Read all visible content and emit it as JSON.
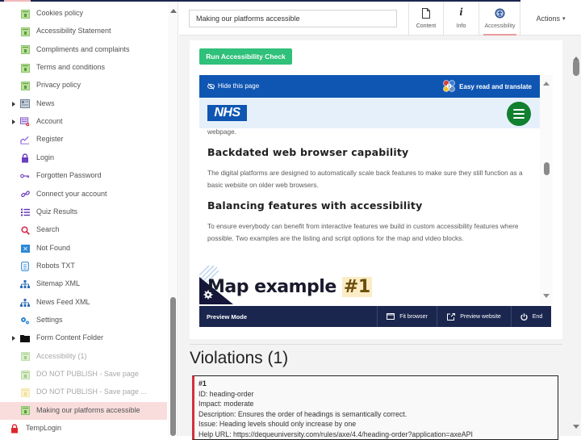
{
  "sidebar": {
    "items": [
      {
        "label": "Cookies policy",
        "icon": "page-icon"
      },
      {
        "label": "Accessibility Statement",
        "icon": "page-icon"
      },
      {
        "label": "Compliments and complaints",
        "icon": "page-icon"
      },
      {
        "label": "Terms and conditions",
        "icon": "page-icon"
      },
      {
        "label": "Privacy policy",
        "icon": "page-icon"
      },
      {
        "label": "News",
        "icon": "news-icon",
        "expandable": true
      },
      {
        "label": "Account",
        "icon": "account-icon",
        "expandable": true
      },
      {
        "label": "Register",
        "icon": "register-icon"
      },
      {
        "label": "Login",
        "icon": "lock-icon"
      },
      {
        "label": "Forgotten Password",
        "icon": "key-icon"
      },
      {
        "label": "Connect your account",
        "icon": "link-icon"
      },
      {
        "label": "Quiz Results",
        "icon": "list-icon"
      },
      {
        "label": "Search",
        "icon": "search-icon"
      },
      {
        "label": "Not Found",
        "icon": "not-found-icon"
      },
      {
        "label": "Robots TXT",
        "icon": "robots-icon"
      },
      {
        "label": "Sitemap XML",
        "icon": "sitemap-icon"
      },
      {
        "label": "News Feed XML",
        "icon": "sitemap-icon"
      },
      {
        "label": "Settings",
        "icon": "settings-icon"
      },
      {
        "label": "Form Content Folder",
        "icon": "folder-icon",
        "expandable": true
      },
      {
        "label": "Accessibility (1)",
        "icon": "page-icon",
        "unpublished": true
      },
      {
        "label": "DO NOT PUBLISH - Save page",
        "icon": "page-icon",
        "unpublished": true
      },
      {
        "label": "DO NOT PUBLISH - Save page ...",
        "icon": "form-icon",
        "unpublished": true
      },
      {
        "label": "Making our platforms accessible",
        "icon": "page-icon",
        "selected": true
      },
      {
        "label": "TempLogin",
        "icon": "red-lock-icon",
        "root": true
      }
    ]
  },
  "header": {
    "page_title": "Making our platforms accessible",
    "tabs": [
      {
        "label": "Content",
        "icon": "document-icon"
      },
      {
        "label": "Info",
        "icon": "info-icon"
      },
      {
        "label": "Accessibility",
        "icon": "accessibility-icon",
        "active": true
      }
    ],
    "actions_label": "Actions",
    "actions_caret": "▾"
  },
  "accessibility": {
    "run_button": "Run Accessibility Check",
    "preview": {
      "hide_label": "Hide this page",
      "easy_read_label": "Easy read and translate",
      "logo_text": "NHS",
      "intro_tail": "webpage.",
      "sections": [
        {
          "heading": "Backdated web browser capability",
          "body": "The digital platforms are designed to automatically scale back features to make sure they still function as a basic website on older web browsers."
        },
        {
          "heading": "Balancing features with accessibility",
          "body": "To ensure everybody can benefit from interactive features we build in custom accessibility features where possible. Two examples are the listing and script options for the map and video blocks."
        }
      ],
      "map_title": "Map example",
      "map_title_highlight": "#1"
    },
    "preview_bar": {
      "mode_label": "Preview Mode",
      "fit_browser": "Fit browser",
      "preview_website": "Preview website",
      "end": "End"
    },
    "violations_title": "Violations (1)",
    "violation": {
      "number": "#1",
      "id": "ID: heading-order",
      "impact": "Impact: moderate",
      "description": "Description: Ensures the order of headings is semantically correct.",
      "issue": "Issue: Heading levels should only increase by one",
      "help_url": "Help URL: https://dequeuniversity.com/rules/axe/4.4/heading-order?application=axeAPI"
    }
  },
  "colors": {
    "accent_pink": "#ec9a9a",
    "run_button": "#2fc07a",
    "nhs_blue": "#0f56b3",
    "preview_bar": "#1b264f",
    "violation_border": "#d0313a"
  }
}
